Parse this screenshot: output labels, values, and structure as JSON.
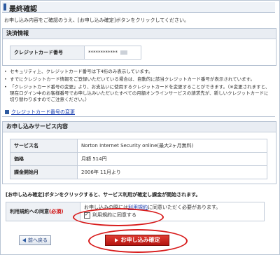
{
  "page": {
    "title": "最終確認",
    "intro": "お申し込み内容をご確認のうえ、[お申し込み確定]ボタンをクリックしてください。"
  },
  "payment": {
    "heading": "決済情報",
    "card_label": "クレジットカード番号",
    "card_value": "************",
    "notes": [
      "セキュリティ上、クレジットカード番号は下4桁のみ表示しています。",
      "すでにクレジットカード情報をご登録いただいている場合は、自動的に該当クレジットカード番号が表示されています。",
      "「クレジットカード番号の変更」より、お支払いに使用するクレジットカードを変更することができます。（※変更されますと、現在ログイン中のお客様番号でお申し込みいただいたすべての月額オンラインサービスの請求先が、新しいクレジットカードに切り替わりますのでご注意ください。）"
    ],
    "change_link": "クレジットカード番号の変更"
  },
  "service": {
    "heading": "お申し込みサービス内容",
    "rows": [
      {
        "label": "サービス名",
        "value": "Norton Internet Security online(最大2ヶ月無料)"
      },
      {
        "label": "価格",
        "value": "月額 514円"
      },
      {
        "label": "課金開始月",
        "value": "2006年 11月より"
      }
    ]
  },
  "notice": "[お申し込み確定]ボタンをクリックすると、サービス利用が確定し課金が開始されます。",
  "agreement": {
    "label_main": "利用規約への同意",
    "label_req": "(必須)",
    "text_pre": "お申し込みの際には",
    "text_link": "利用規約",
    "text_post": "に同意いただく必要があります。",
    "checkbox_label": "利用規約に同意する"
  },
  "buttons": {
    "back": "前へ戻る",
    "confirm": "お申し込み確定"
  }
}
